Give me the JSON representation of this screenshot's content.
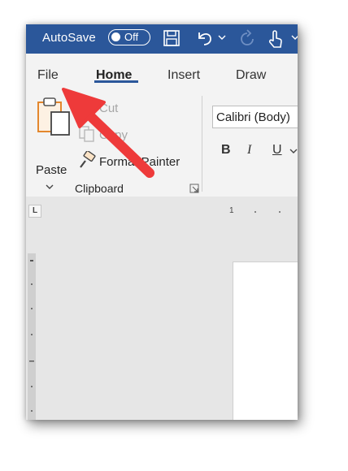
{
  "titlebar": {
    "autosave_label": "AutoSave",
    "autosave_state": "Off",
    "color": "#2b579a",
    "icons": [
      "save-icon",
      "undo-icon",
      "redo-icon",
      "touch-mode-icon"
    ]
  },
  "tabs": [
    {
      "label": "File",
      "active": false
    },
    {
      "label": "Home",
      "active": true
    },
    {
      "label": "Insert",
      "active": false
    },
    {
      "label": "Draw",
      "active": false
    }
  ],
  "clipboard": {
    "paste_label": "Paste",
    "cut_label": "Cut",
    "copy_label": "Copy",
    "format_painter_label": "Format Painter",
    "group_label": "Clipboard"
  },
  "font": {
    "name": "Calibri (Body)",
    "bold": "B",
    "italic": "I",
    "underline": "U"
  },
  "ruler": {
    "tab_selector": "L",
    "first_mark": "1"
  },
  "annotation": {
    "type": "arrow",
    "points_to": "File tab",
    "color": "#ee3a3a"
  }
}
